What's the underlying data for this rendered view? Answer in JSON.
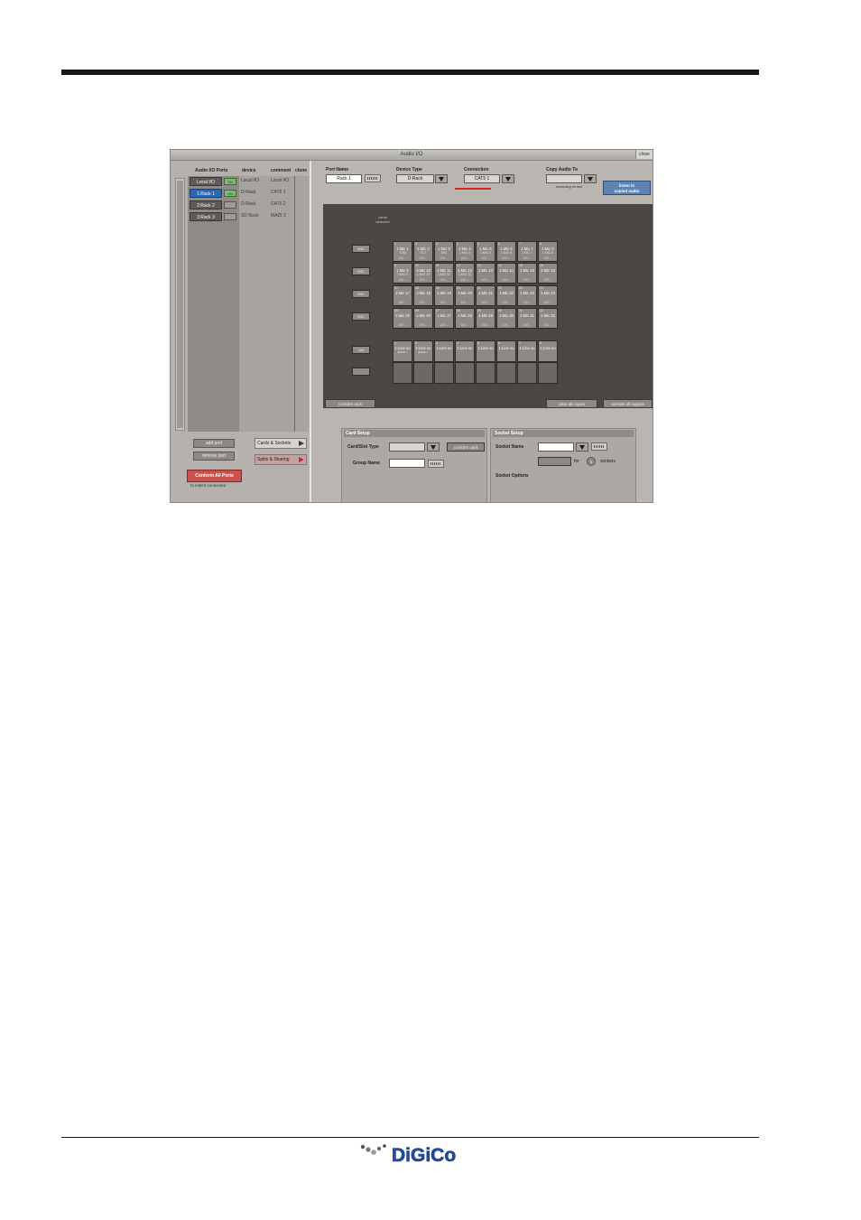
{
  "window": {
    "title": "Audio I/O",
    "close_label": "close"
  },
  "ports_table": {
    "headers": [
      "Audio I/O Ports",
      "device",
      "comment",
      "clone"
    ],
    "rows": [
      {
        "name": "Local I/O",
        "status": "ON",
        "device": "Local I/O",
        "comment": "Local I/O",
        "selected": false,
        "led": "on"
      },
      {
        "name": "1:Rack 1",
        "status": "ON",
        "device": "D-Rack",
        "comment": "CAT5 1",
        "selected": true,
        "led": "on"
      },
      {
        "name": "2:Rack 2",
        "status": "",
        "device": "D-Rack",
        "comment": "CAT5 2",
        "selected": false,
        "led": "off"
      },
      {
        "name": "3:Rack 3",
        "status": "",
        "device": "SD Rack",
        "comment": "MADI 3",
        "selected": false,
        "led": "off"
      }
    ],
    "add_port": "add port",
    "remove_port": "remove port",
    "conform_all": "Conform All Ports",
    "conform_note": "to match connected"
  },
  "nav": {
    "cards_sockets": "Cards & Sockets",
    "splits_sharing": "Splits & Sharing"
  },
  "port_settings": {
    "port_name_label": "Port Name",
    "port_name_value": "Rack 1",
    "device_type_label": "Device Type",
    "device_type_value": "D-Rack",
    "connection_label": "Connection",
    "connection_value": "CAT5 1",
    "copy_audio_label": "Copy Audio To",
    "copy_audio_value": "",
    "copy_audio_note": "excluding muted",
    "listen_label_1": "listen to",
    "listen_label_2": "copied audio"
  },
  "rack_view": {
    "cards_detected_1": "cards",
    "cards_detected_2": "detected",
    "card_buttons": [
      "MIC",
      "MIC",
      "MIC",
      "MIC",
      "LIN",
      ""
    ],
    "input_rows": [
      [
        {
          "n": "1",
          "a": "1:Mic 1",
          "b": "TOM",
          "c": "100 --"
        },
        {
          "n": "2",
          "a": "1:Mic 2",
          "b": "OCT",
          "c": "100 --"
        },
        {
          "n": "3",
          "a": "1:Mic 3",
          "b": "SN1",
          "c": "100 --"
        },
        {
          "n": "4",
          "a": "1:Mic 4",
          "b": "1:MIC 4",
          "c": "100 --"
        },
        {
          "n": "5",
          "a": "1:Mic 5",
          "b": "1:MIC 5",
          "c": "100 --"
        },
        {
          "n": "6",
          "a": "1:Mic 6",
          "b": "1:MIC 6",
          "c": "100 --"
        },
        {
          "n": "7",
          "a": "1:Mic 7",
          "b": "1:MIC 7",
          "c": "100 --"
        },
        {
          "n": "8",
          "a": "1:Mic 8",
          "b": "1:MIC 8",
          "c": "100 --"
        }
      ],
      [
        {
          "n": "9",
          "a": "1:Mic 9",
          "b": "1:MIC 9",
          "c": "100 --"
        },
        {
          "n": "10",
          "a": "1:Mic 10",
          "b": "1:MIC 10",
          "c": "100 --"
        },
        {
          "n": "11",
          "a": "1:Mic 11",
          "b": "1:MIC 11",
          "c": "100 --"
        },
        {
          "n": "12",
          "a": "1:Mic 12",
          "b": "1:MIC 12",
          "c": "100 --"
        },
        {
          "n": "13",
          "a": "1:Mic 13",
          "b": "",
          "c": "100 --"
        },
        {
          "n": "14",
          "a": "1:Mic 14",
          "b": "",
          "c": "100 --"
        },
        {
          "n": "15",
          "a": "1:Mic 15",
          "b": "",
          "c": "100 --"
        },
        {
          "n": "16",
          "a": "1:Mic 16",
          "b": "",
          "c": "100 --"
        }
      ],
      [
        {
          "n": "17",
          "a": "1:Mic 17",
          "b": "",
          "c": "100 --"
        },
        {
          "n": "18",
          "a": "1:Mic 18",
          "b": "",
          "c": "100 --"
        },
        {
          "n": "19",
          "a": "1:Mic 19",
          "b": "",
          "c": "100 --"
        },
        {
          "n": "20",
          "a": "1:Mic 20",
          "b": "",
          "c": "100 --"
        },
        {
          "n": "21",
          "a": "1:Mic 21",
          "b": "",
          "c": "100 --"
        },
        {
          "n": "22",
          "a": "1:Mic 22",
          "b": "",
          "c": "100 --"
        },
        {
          "n": "23",
          "a": "1:Mic 23",
          "b": "",
          "c": "100 --"
        },
        {
          "n": "24",
          "a": "1:Mic 24",
          "b": "",
          "c": "100 --"
        }
      ],
      [
        {
          "n": "25",
          "a": "1:Mic 25",
          "b": "",
          "c": "100 --"
        },
        {
          "n": "26",
          "a": "1:Mic 26",
          "b": "",
          "c": "100 --"
        },
        {
          "n": "27",
          "a": "1:Mic 27",
          "b": "",
          "c": "100 --"
        },
        {
          "n": "28",
          "a": "1:Mic 28",
          "b": "",
          "c": "100 --"
        },
        {
          "n": "29",
          "a": "1:Mic 29",
          "b": "",
          "c": "100 --"
        },
        {
          "n": "30",
          "a": "1:Mic 30",
          "b": "",
          "c": "100 --"
        },
        {
          "n": "31",
          "a": "1:Mic 31",
          "b": "",
          "c": "100 --"
        },
        {
          "n": "32",
          "a": "1:Mic 32",
          "b": "",
          "c": "100 --"
        }
      ]
    ],
    "output_row": [
      {
        "n": "1",
        "a": "1:Line ou",
        "b": "stack ="
      },
      {
        "n": "2",
        "a": "1:Line ou",
        "b": "stack ="
      },
      {
        "n": "3",
        "a": "1:Line ou",
        "b": ""
      },
      {
        "n": "4",
        "a": "1:Line ou",
        "b": ""
      },
      {
        "n": "5",
        "a": "1:Line ou",
        "b": ""
      },
      {
        "n": "6",
        "a": "1:Line ou",
        "b": ""
      },
      {
        "n": "7",
        "a": "1:Line ou",
        "b": ""
      },
      {
        "n": "8",
        "a": "1:Line ou",
        "b": ""
      }
    ],
    "conform_rack": "conform rack",
    "clear_copies": "clear all copies",
    "unmute_outputs": "unmute all outputs"
  },
  "card_setup": {
    "title": "Card Setup",
    "slot_type_label": "Card/Slot Type",
    "slot_type_value": "",
    "conform_card": "conform card",
    "group_name_label": "Group Name",
    "group_name_value": ""
  },
  "socket_setup": {
    "title": "Socket Setup",
    "socket_name_label": "Socket Name",
    "socket_name_value": "",
    "apply_label": "",
    "for_label": "for",
    "count": "1",
    "sockets_label": "sockets",
    "options_label": "Socket Options"
  },
  "footer": {
    "logo_text": "DiGiCo"
  },
  "colors": {
    "accent_blue": "#2a68b4",
    "status_green": "#74c26a",
    "conform_red": "#c9524f",
    "logo_blue": "#1f4fa3"
  }
}
